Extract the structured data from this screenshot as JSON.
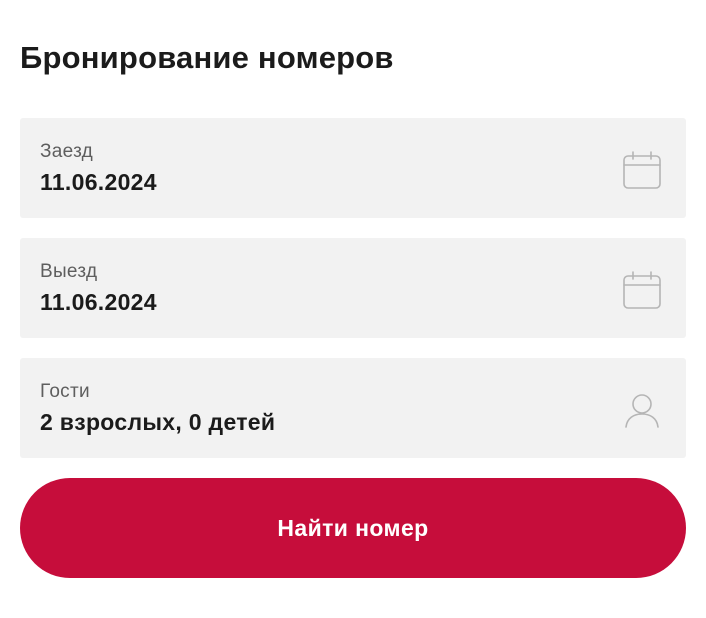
{
  "booking": {
    "title": "Бронирование номеров",
    "checkin": {
      "label": "Заезд",
      "value": "11.06.2024",
      "icon": "calendar-icon"
    },
    "checkout": {
      "label": "Выезд",
      "value": "11.06.2024",
      "icon": "calendar-icon"
    },
    "guests": {
      "label": "Гости",
      "value": "2 взрослых, 0 детей",
      "icon": "person-icon"
    },
    "submit_label": "Найти номер"
  },
  "colors": {
    "accent": "#c60d3b",
    "field_background": "#f2f2f2",
    "text": "#1b1b1b",
    "label_text": "#5e5e5e",
    "icon_stroke": "#b5b5b5"
  }
}
